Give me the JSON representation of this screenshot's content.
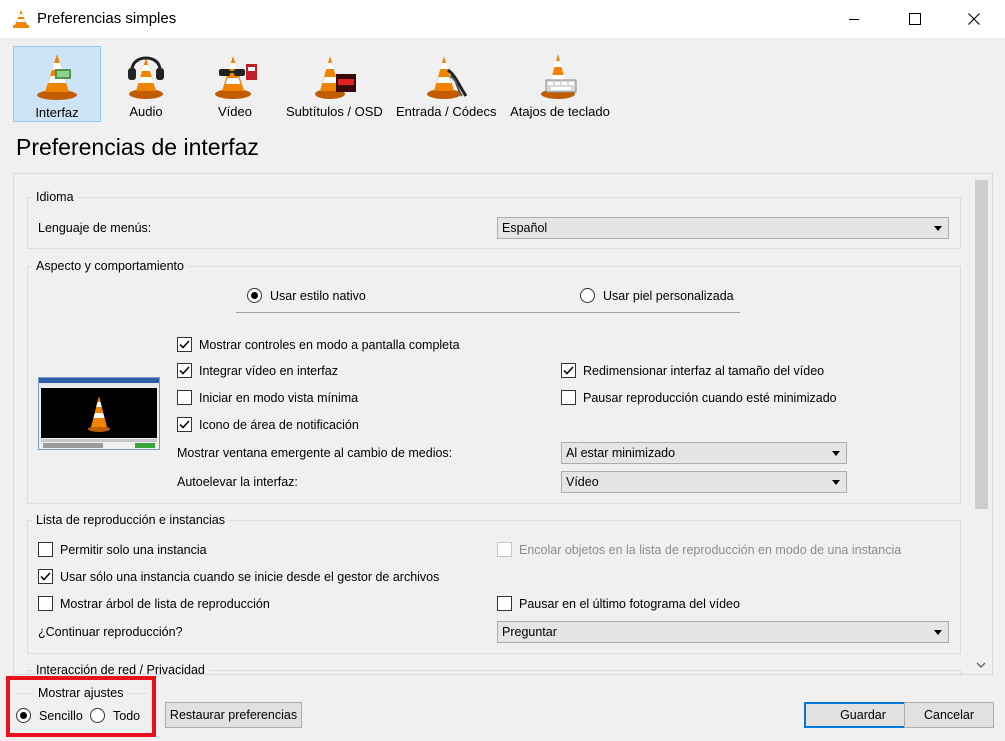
{
  "window": {
    "title": "Preferencias simples"
  },
  "categories": [
    {
      "label": "Interfaz",
      "icon": "vlc-cone-interface-icon"
    },
    {
      "label": "Audio",
      "icon": "vlc-cone-headphones-icon"
    },
    {
      "label": "Vídeo",
      "icon": "vlc-cone-glasses-icon"
    },
    {
      "label": "Subtítulos / OSD",
      "icon": "vlc-cone-display-icon"
    },
    {
      "label": "Entrada / Códecs",
      "icon": "vlc-cone-cables-icon"
    },
    {
      "label": "Atajos de teclado",
      "icon": "vlc-cone-keyboard-icon"
    }
  ],
  "section_title": "Preferencias de interfaz",
  "idioma": {
    "title": "Idioma",
    "menu_language_label": "Lenguaje de menús:",
    "menu_language_value": "Español"
  },
  "aspecto": {
    "title": "Aspecto y comportamiento",
    "radio_native": "Usar estilo nativo",
    "radio_skin": "Usar piel personalizada",
    "selected_style": "Usar estilo nativo",
    "checkboxes": {
      "fullscreen_controls": {
        "label": "Mostrar controles en modo a pantalla completa",
        "checked": true
      },
      "embed_video": {
        "label": "Integrar vídeo en interfaz",
        "checked": true
      },
      "resize_interface": {
        "label": "Redimensionar interfaz al tamaño del vídeo",
        "checked": true
      },
      "minimal_view": {
        "label": "Iniciar en modo vista mínima",
        "checked": false
      },
      "pause_minimized": {
        "label": "Pausar reproducción cuando esté minimizado",
        "checked": false
      },
      "systray_icon": {
        "label": "Icono de área de notificación",
        "checked": true
      }
    },
    "popup_label": "Mostrar ventana emergente al cambio de medios:",
    "popup_value": "Al estar minimizado",
    "raise_label": "Autoelevar la interfaz:",
    "raise_value": "Vídeo"
  },
  "playlist": {
    "title": "Lista de reproducción e instancias",
    "checkboxes": {
      "one_instance": {
        "label": "Permitir solo una instancia",
        "checked": false
      },
      "enqueue_one_instance": {
        "label": "Encolar objetos en la lista de reproducción en modo de una instancia",
        "checked": false,
        "disabled": true
      },
      "one_instance_file_manager": {
        "label": "Usar sólo una instancia cuando se inicie desde el gestor de archivos",
        "checked": true
      },
      "show_playlist_tree": {
        "label": "Mostrar árbol de lista de reproducción",
        "checked": false
      },
      "pause_last_frame": {
        "label": "Pausar en el último fotograma del vídeo",
        "checked": false
      }
    },
    "continue_label": "¿Continuar reproducción?",
    "continue_value": "Preguntar"
  },
  "network_group_title": "Interacción de red / Privacidad",
  "footer": {
    "show_settings_title": "Mostrar ajustes",
    "simple_label": "Sencillo",
    "all_label": "Todo",
    "selected_mode": "Sencillo",
    "reset_button": "Restaurar preferencias",
    "save_button": "Guardar",
    "cancel_button": "Cancelar"
  },
  "colors": {
    "selected_category_bg": "#cde4f7",
    "highlight_box": "#e8111d",
    "default_button_border": "#0078d7",
    "vlc_orange": "#f08300"
  }
}
